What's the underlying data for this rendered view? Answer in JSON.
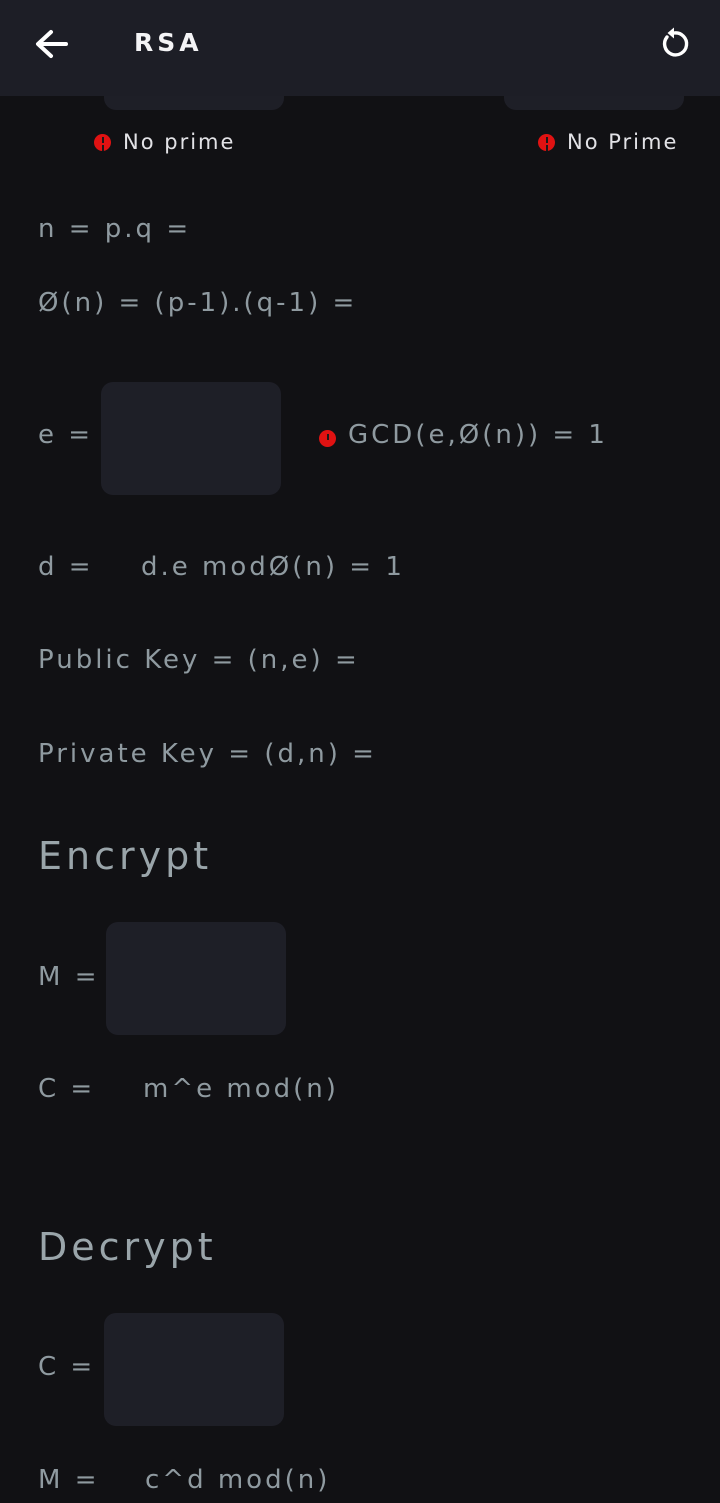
{
  "appbar": {
    "title": "RSA",
    "back_icon": "arrow-left-icon",
    "reset_icon": "refresh-icon"
  },
  "prime_inputs": {
    "p_status": "No prime",
    "q_status": "No Prime"
  },
  "formulas": {
    "n": "n = p.q =",
    "phi": "Ø(n) = (p-1).(q-1) =",
    "e_label": "e =",
    "e_condition": "GCD(e,Ø(n)) = 1",
    "d_label": "d =",
    "d_condition": "d.e modØ(n) = 1",
    "public_key": "Public Key = (n,e) =",
    "private_key": "Private Key = (d,n) ="
  },
  "encrypt": {
    "heading": "Encrypt",
    "m_label": "M =",
    "c_label": "C =",
    "c_formula": "m^e mod(n)"
  },
  "decrypt": {
    "heading": "Decrypt",
    "c_label": "C =",
    "m_label": "M =",
    "m_formula": "c^d mod(n)"
  },
  "colors": {
    "background": "#111114",
    "appbar": "#1d1e26",
    "input": "#1e1f27",
    "label": "#8f9aa0",
    "error": "#e01212"
  }
}
